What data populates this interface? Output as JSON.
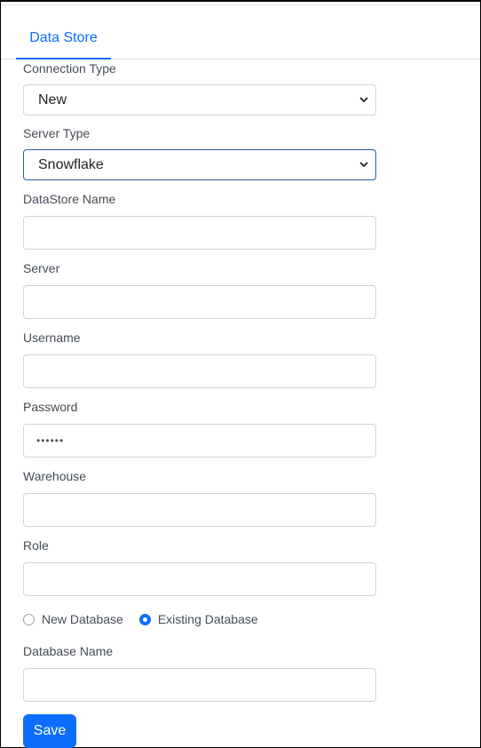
{
  "tabs": [
    {
      "label": "Data Store",
      "active": true
    }
  ],
  "form": {
    "connection_type": {
      "label": "Connection Type",
      "value": "New"
    },
    "server_type": {
      "label": "Server Type",
      "value": "Snowflake"
    },
    "datastore_name": {
      "label": "DataStore Name",
      "value": ""
    },
    "server": {
      "label": "Server",
      "value": ""
    },
    "username": {
      "label": "Username",
      "value": ""
    },
    "password": {
      "label": "Password",
      "value": "••••••"
    },
    "warehouse": {
      "label": "Warehouse",
      "value": ""
    },
    "role": {
      "label": "Role",
      "value": ""
    },
    "database_mode": {
      "options": [
        {
          "label": "New Database",
          "checked": false
        },
        {
          "label": "Existing Database",
          "checked": true
        }
      ]
    },
    "database_name": {
      "label": "Database Name",
      "value": ""
    },
    "save_label": "Save"
  },
  "colors": {
    "accent": "#0d6efd",
    "focus_border": "#2d5ca8"
  }
}
